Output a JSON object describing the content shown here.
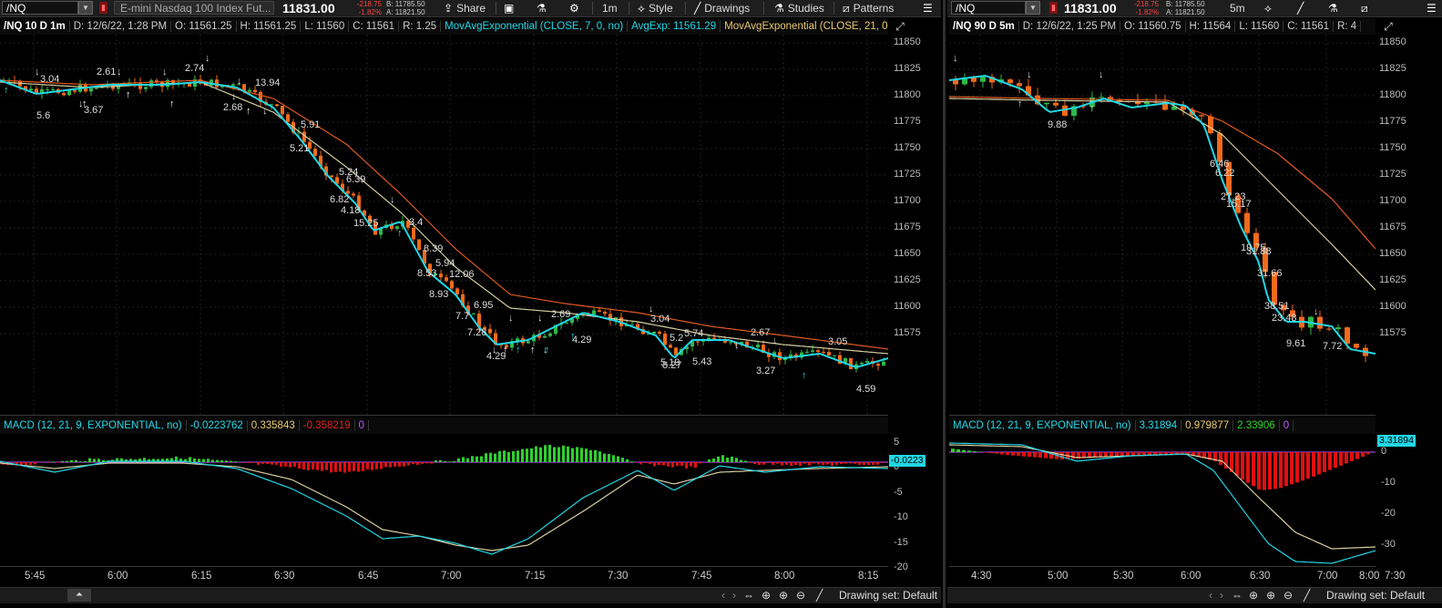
{
  "left": {
    "toolbar": {
      "symbol": "/NQ",
      "description": "E-mini Nasdaq 100 Index Fut...",
      "price": "11831.00",
      "change": "-218.75",
      "change_pct": "-1.82%",
      "bid": "B: 11785.50",
      "ask": "A: 11821.50",
      "share_label": "Share",
      "timeframe": "1m",
      "style_label": "Style",
      "drawings_label": "Drawings",
      "studies_label": "Studies",
      "patterns_label": "Patterns"
    },
    "header": {
      "title": "/NQ 10 D 1m",
      "date": "D: 12/6/22, 1:28 PM",
      "open": "O: 11561.25",
      "high": "H: 11561.25",
      "low": "L: 11560",
      "close": "C: 11561",
      "range": "R: 1.25",
      "ema7_name": "MovAvgExponential (CLOSE, 7, 0, no)",
      "ema7_value": "AvgExp: 11561.29",
      "ema21_name": "MovAvgExponential (CLOSE, 21, 0, no) ..."
    },
    "price_axis": [
      "11850",
      "11825",
      "11800",
      "11775",
      "11750",
      "11725",
      "11700",
      "11675",
      "11650",
      "11625",
      "11600",
      "11575"
    ],
    "macd": {
      "name": "MACD (12, 21, 9, EXPONENTIAL, no)",
      "value": "-0.0223762",
      "avg": "0.335843",
      "diff": "-0.358219",
      "zero": "0",
      "axis": [
        "5",
        "0",
        "-5",
        "-10",
        "-15",
        "-20"
      ],
      "current_tag": "-0.0223"
    },
    "time_axis": [
      "5:45",
      "6:00",
      "6:15",
      "6:30",
      "6:45",
      "7:00",
      "7:15",
      "7:30",
      "7:45",
      "8:00",
      "8:15"
    ],
    "drawing_set": "Drawing set: Default",
    "markers": [
      "3.04",
      "5.6",
      "2.61",
      "3.67",
      "2.74",
      "2.68",
      "13.94",
      "5.21",
      "5.91",
      "6.82",
      "5.24",
      "4.18",
      "6.39",
      "15.25",
      "3.4",
      "8.53",
      "8.39",
      "8.93",
      "5.94",
      "7.7",
      "12.06",
      "7.28",
      "6.95",
      "4.29",
      "2.69",
      "4.29",
      "5.74",
      "5.43",
      "3.04",
      "5.19",
      "5.2",
      "8.27",
      "2.67",
      "3.27",
      "3.05",
      "4.59"
    ]
  },
  "right": {
    "toolbar": {
      "symbol": "/NQ",
      "price": "11831.00",
      "change": "-218.75",
      "change_pct": "-1.82%",
      "bid": "B: 11785.50",
      "ask": "A: 11821.50",
      "timeframe": "5m"
    },
    "header": {
      "title": "/NQ 90 D 5m",
      "date": "D: 12/6/22, 1:25 PM",
      "open": "O: 11560.75",
      "high": "H: 11564",
      "low": "L: 11560",
      "close": "C: 11561",
      "range": "R: 4"
    },
    "price_axis": [
      "11850",
      "11825",
      "11800",
      "11775",
      "11750",
      "11725",
      "11700",
      "11675",
      "11650",
      "11625",
      "11600",
      "11575"
    ],
    "macd": {
      "name": "MACD (12, 21, 9, EXPONENTIAL, no)",
      "value": "3.31894",
      "avg": "0.979877",
      "diff": "2.33906",
      "zero": "0",
      "axis": [
        "0",
        "-10",
        "-20",
        "-30"
      ],
      "current_tag": "3.31894"
    },
    "time_axis": [
      "4:30",
      "5:00",
      "5:30",
      "6:00",
      "6:30",
      "7:00",
      "7:30",
      "8:00"
    ],
    "markers": [
      "9.88",
      "6.46",
      "6.22",
      "27.23",
      "15.17",
      "19.75",
      "31.88",
      "38.51",
      "23.48",
      "9.61",
      "31.66",
      "7.72"
    ]
  },
  "colors": {
    "up": "#2fb84a",
    "down": "#f26a1b",
    "ema7": "#22d7e6",
    "ema21": "#e05a1f",
    "ema_mid": "#d8cfa0",
    "macd_pos": "#2fd02f",
    "macd_neg": "#e01010"
  }
}
